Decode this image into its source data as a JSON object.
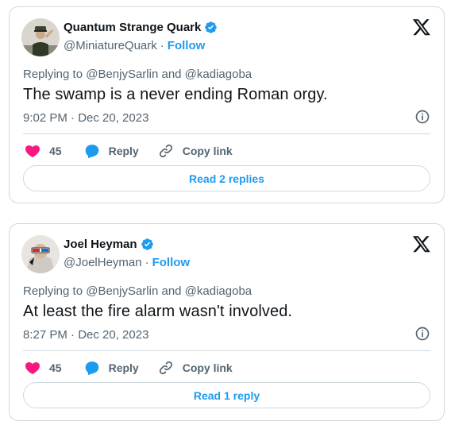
{
  "tweets": [
    {
      "name": "Quantum Strange Quark",
      "handle": "@MiniatureQuark",
      "separator": "·",
      "follow": "Follow",
      "replying": "Replying to @BenjySarlin and @kadiagoba",
      "text": "The swamp is a never ending Roman orgy.",
      "timestamp": "9:02 PM · Dec 20, 2023",
      "likes": "45",
      "reply_label": "Reply",
      "copy_label": "Copy link",
      "replies_button": "Read 2 replies",
      "avatar_icon": "soldier-saluting-avatar"
    },
    {
      "name": "Joel Heyman",
      "handle": "@JoelHeyman",
      "separator": "·",
      "follow": "Follow",
      "replying": "Replying to @BenjySarlin and @kadiagoba",
      "text": "At least the fire alarm wasn't involved.",
      "timestamp": "8:27 PM · Dec 20, 2023",
      "likes": "45",
      "reply_label": "Reply",
      "copy_label": "Copy link",
      "replies_button": "Read 1 reply",
      "avatar_icon": "3d-glasses-avatar"
    }
  ],
  "colors": {
    "accent": "#1d9bf0",
    "like": "#f91880",
    "text": "#0f1419",
    "muted": "#536471",
    "border": "#cfd9de"
  }
}
